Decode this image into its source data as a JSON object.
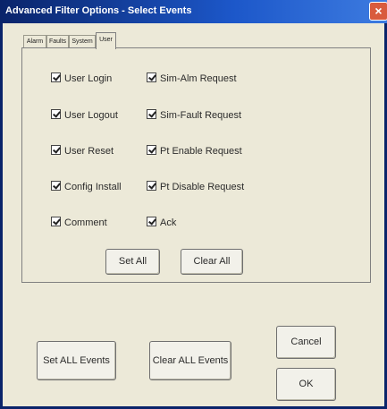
{
  "window": {
    "title": "Advanced Filter Options - Select Events",
    "close_label": "×"
  },
  "tabs": [
    "Alarm",
    "Faults",
    "System",
    "User"
  ],
  "active_tab": "User",
  "checkboxes_left": [
    {
      "label": "User Login",
      "checked": true
    },
    {
      "label": "User Logout",
      "checked": true
    },
    {
      "label": "User Reset",
      "checked": true
    },
    {
      "label": "Config Install",
      "checked": true
    },
    {
      "label": "Comment",
      "checked": true
    }
  ],
  "checkboxes_right": [
    {
      "label": "Sim-Alm Request",
      "checked": true
    },
    {
      "label": "Sim-Fault Request",
      "checked": true
    },
    {
      "label": "Pt Enable Request",
      "checked": true
    },
    {
      "label": "Pt Disable Request",
      "checked": true
    },
    {
      "label": "Ack",
      "checked": true
    }
  ],
  "panel_buttons": {
    "set_all": "Set All",
    "clear_all": "Clear All"
  },
  "footer_buttons": {
    "set_all_events": "Set ALL Events",
    "clear_all_events": "Clear ALL Events",
    "cancel": "Cancel",
    "ok": "OK"
  }
}
